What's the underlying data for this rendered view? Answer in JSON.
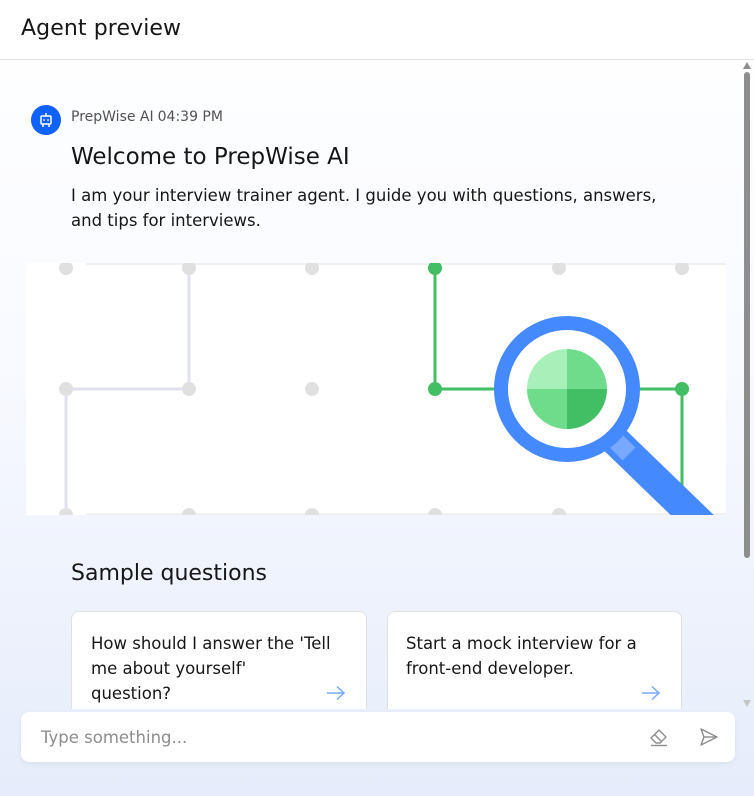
{
  "header": {
    "title": "Agent preview"
  },
  "message": {
    "sender": "PrepWise AI",
    "time": "04:39 PM",
    "avatar_icon": "robot-icon",
    "title": "Welcome to PrepWise AI",
    "body": "I am your interview trainer agent. I guide you with questions, answers, and tips for interviews."
  },
  "illustration": {
    "icon": "magnifier-illustration"
  },
  "samples": {
    "title": "Sample questions",
    "items": [
      {
        "text": "How should I answer the 'Tell me about yourself' question?",
        "icon": "arrow-right-icon"
      },
      {
        "text": "Start a mock interview for a front-end developer.",
        "icon": "arrow-right-icon"
      }
    ]
  },
  "input": {
    "placeholder": "Type something..."
  },
  "colors": {
    "accent": "#0f62fe",
    "green": "#42be65",
    "magnifier": "#4589ff"
  }
}
